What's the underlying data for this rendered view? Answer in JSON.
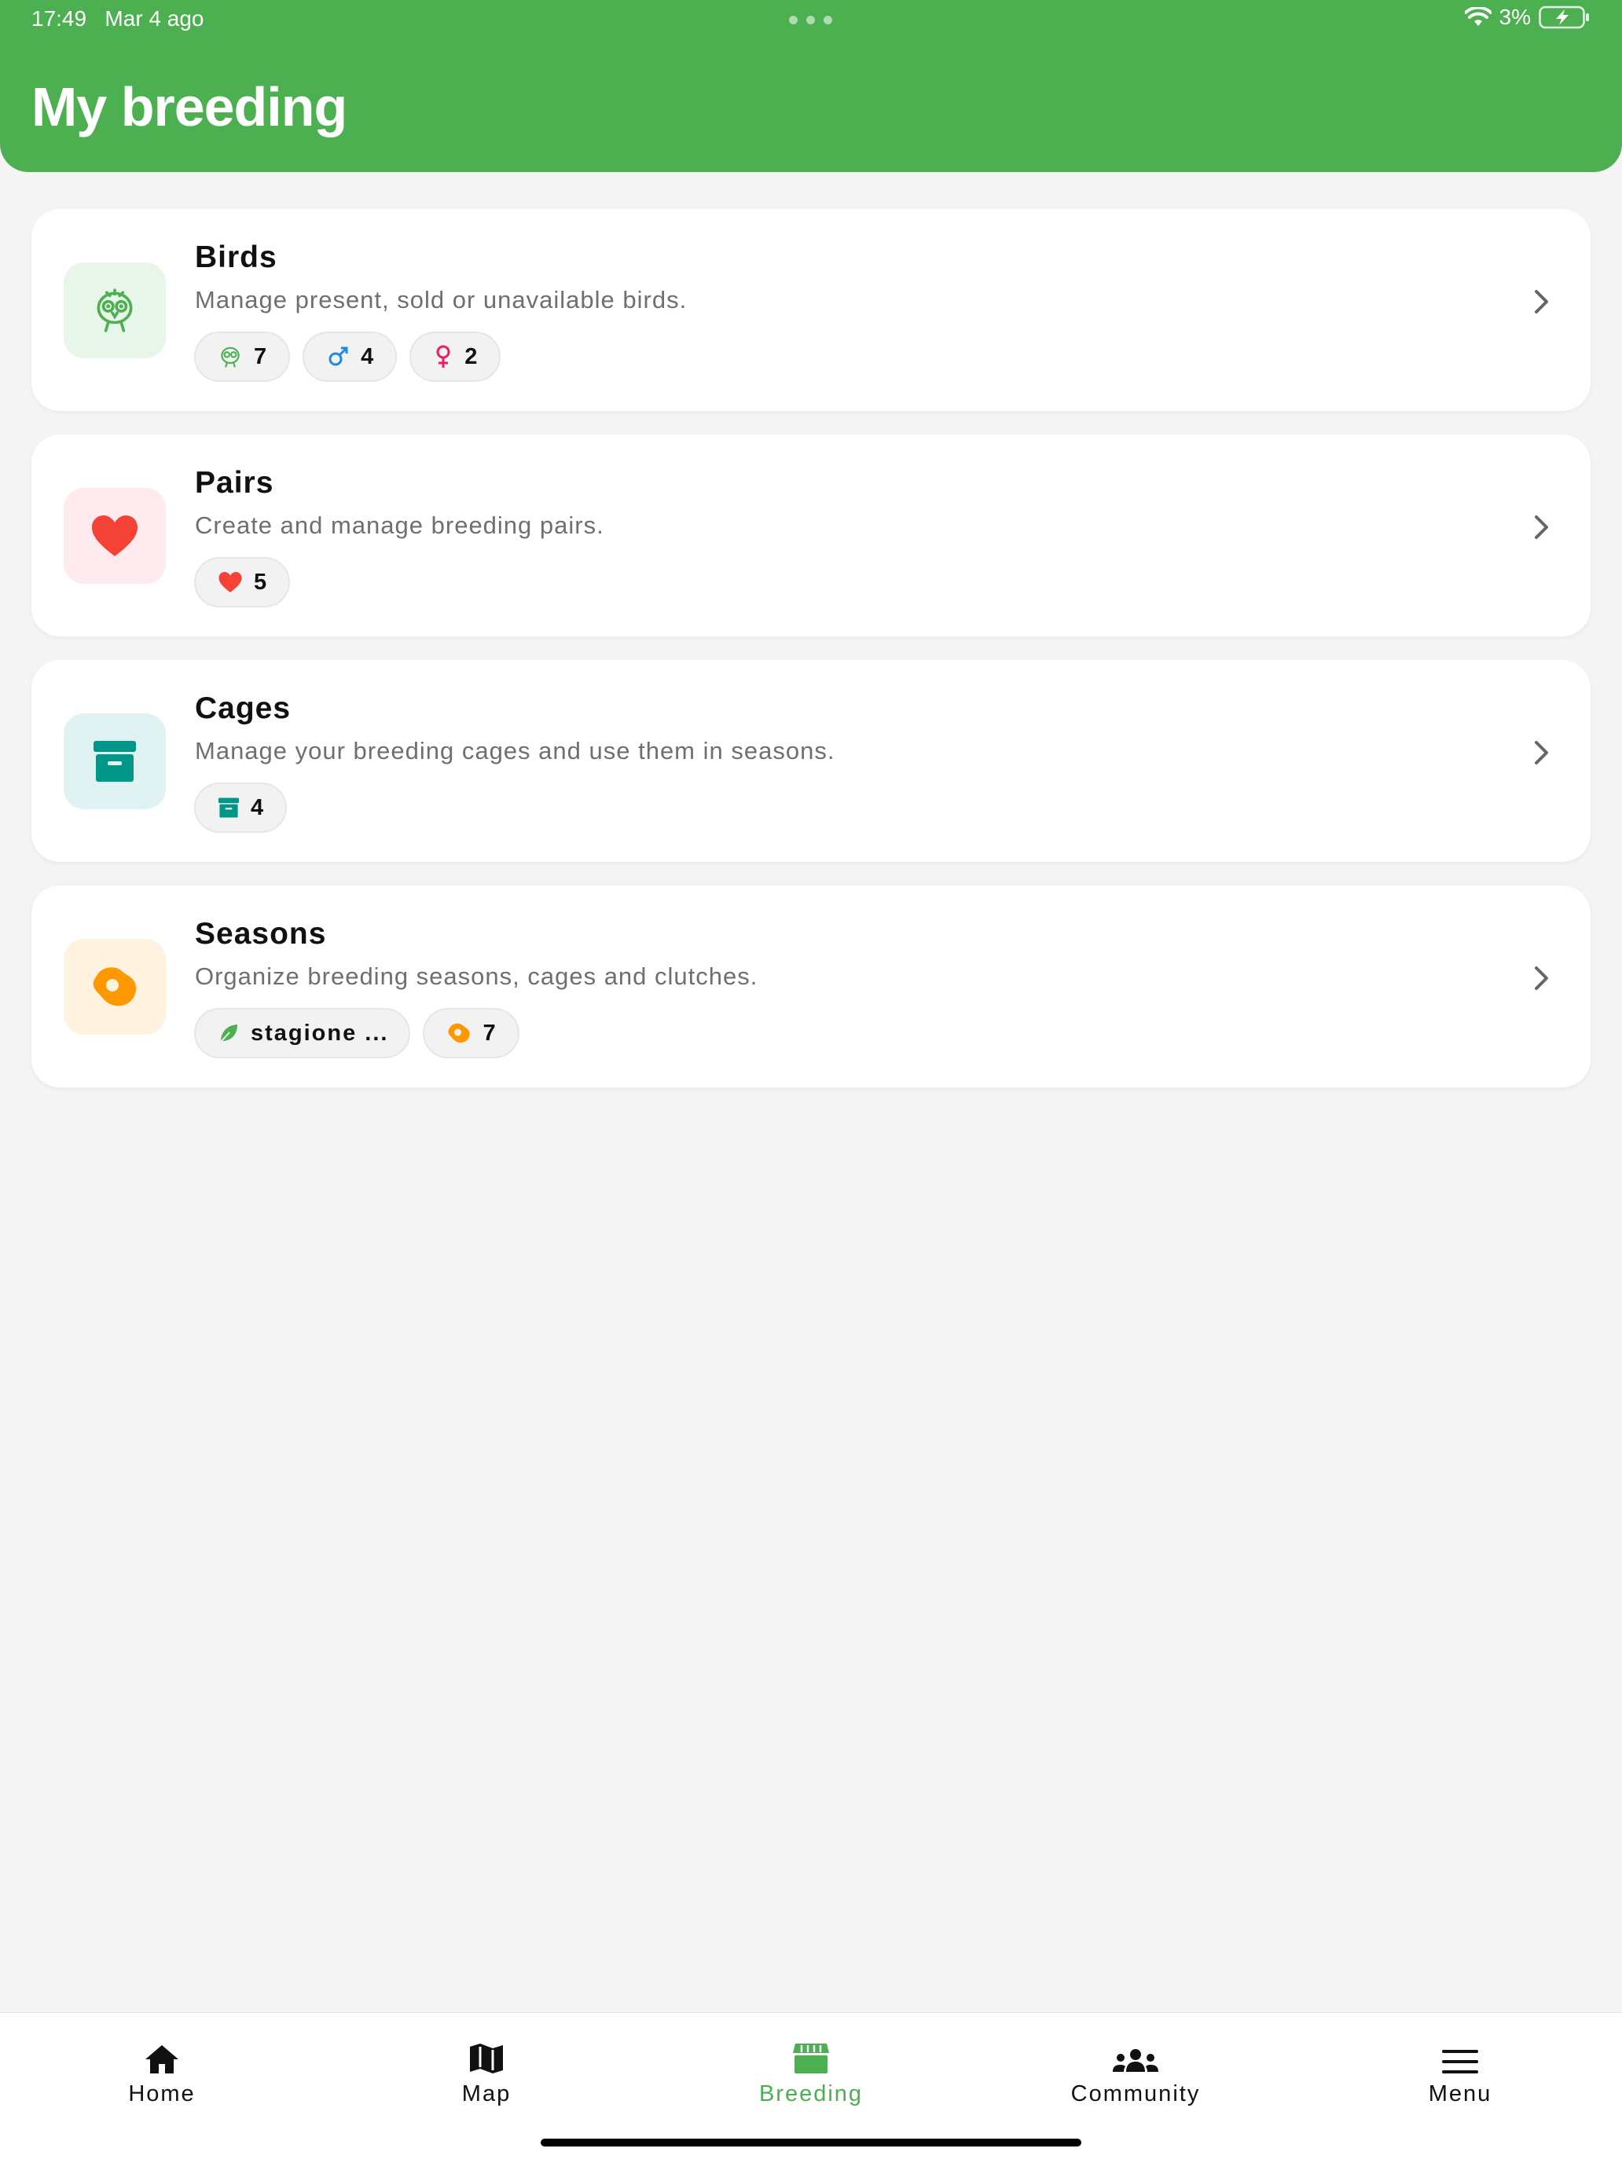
{
  "status_bar": {
    "time": "17:49",
    "date": "Mar 4 ago",
    "battery": "3%"
  },
  "page": {
    "title": "My breeding"
  },
  "cards": [
    {
      "title": "Birds",
      "description": "Manage present, sold or unavailable birds.",
      "icon": "bird-icon",
      "icon_bg": "#e8f5e9",
      "chips": [
        {
          "icon": "bird-icon",
          "value": "7"
        },
        {
          "icon": "male-icon",
          "value": "4"
        },
        {
          "icon": "female-icon",
          "value": "2"
        }
      ]
    },
    {
      "title": "Pairs",
      "description": "Create and manage breeding pairs.",
      "icon": "heart-icon",
      "icon_bg": "#ffebee",
      "chips": [
        {
          "icon": "heart-icon",
          "value": "5"
        }
      ]
    },
    {
      "title": "Cages",
      "description": "Manage your breeding cages and use them in seasons.",
      "icon": "cage-icon",
      "icon_bg": "#e0f2f1",
      "chips": [
        {
          "icon": "cage-icon",
          "value": "4"
        }
      ]
    },
    {
      "title": "Seasons",
      "description": "Organize breeding seasons, cages and clutches.",
      "icon": "egg-icon",
      "icon_bg": "#fff3e0",
      "chips": [
        {
          "icon": "leaf-icon",
          "value": "stagione ..."
        },
        {
          "icon": "egg-icon",
          "value": "7"
        }
      ]
    }
  ],
  "nav": {
    "items": [
      {
        "label": "Home",
        "icon": "home-icon"
      },
      {
        "label": "Map",
        "icon": "map-icon"
      },
      {
        "label": "Breeding",
        "icon": "store-icon",
        "active": true
      },
      {
        "label": "Community",
        "icon": "community-icon"
      },
      {
        "label": "Menu",
        "icon": "menu-icon"
      }
    ]
  },
  "colors": {
    "accent": "#4caf50",
    "heart": "#f44336",
    "cage": "#009688",
    "egg": "#ff9800",
    "male": "#1e88e5",
    "female": "#e91e63"
  }
}
